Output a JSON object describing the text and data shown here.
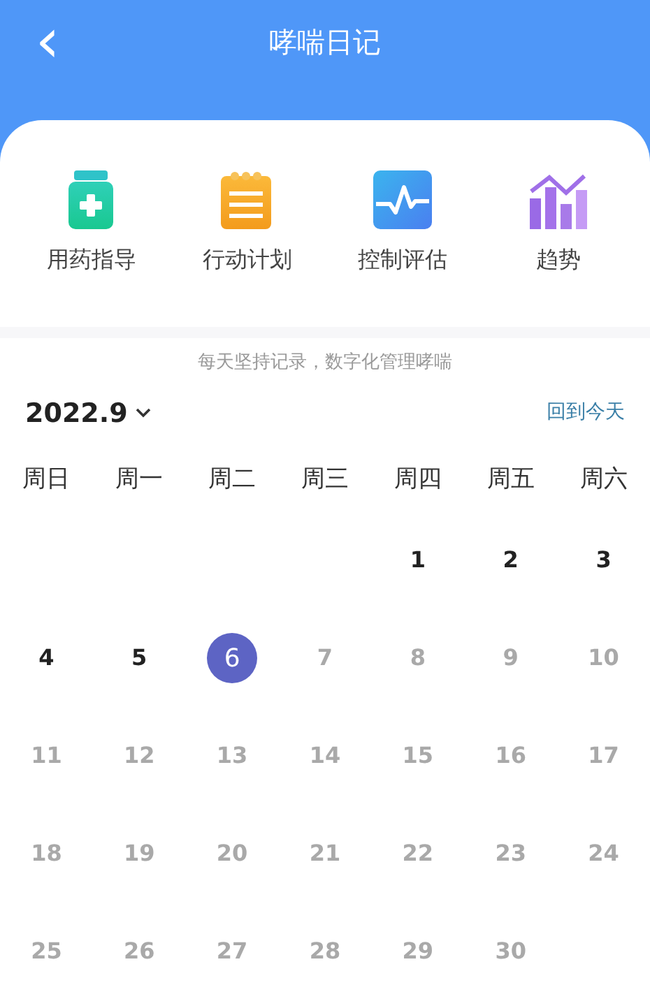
{
  "header": {
    "back": "‹",
    "title": "哮喘日记"
  },
  "shortcuts": [
    {
      "kind": "medicine",
      "label": "用药指导"
    },
    {
      "kind": "plan",
      "label": "行动计划"
    },
    {
      "kind": "assess",
      "label": "控制评估"
    },
    {
      "kind": "trend",
      "label": "趋势"
    }
  ],
  "tagline": "每天坚持记录，数字化管理哮喘",
  "calendar": {
    "month": "2022.9",
    "today_link": "回到今天",
    "weekdays": [
      "周日",
      "周一",
      "周二",
      "周三",
      "周四",
      "周五",
      "周六"
    ],
    "weeks": [
      [
        {
          "kind": "blank"
        },
        {
          "kind": "blank"
        },
        {
          "kind": "blank"
        },
        {
          "kind": "blank"
        },
        {
          "kind": "day",
          "day": "1",
          "selected": false,
          "disabled": false
        },
        {
          "kind": "day",
          "day": "2",
          "selected": false,
          "disabled": false
        },
        {
          "kind": "day",
          "day": "3",
          "selected": false,
          "disabled": false
        }
      ],
      [
        {
          "kind": "day",
          "day": "4",
          "selected": false,
          "disabled": false
        },
        {
          "kind": "day",
          "day": "5",
          "selected": false,
          "disabled": false
        },
        {
          "kind": "day",
          "day": "6",
          "selected": true,
          "disabled": false
        },
        {
          "kind": "day",
          "day": "7",
          "selected": false,
          "disabled": true
        },
        {
          "kind": "day",
          "day": "8",
          "selected": false,
          "disabled": true
        },
        {
          "kind": "day",
          "day": "9",
          "selected": false,
          "disabled": true
        },
        {
          "kind": "day",
          "day": "10",
          "selected": false,
          "disabled": true
        }
      ],
      [
        {
          "kind": "day",
          "day": "11",
          "selected": false,
          "disabled": true
        },
        {
          "kind": "day",
          "day": "12",
          "selected": false,
          "disabled": true
        },
        {
          "kind": "day",
          "day": "13",
          "selected": false,
          "disabled": true
        },
        {
          "kind": "day",
          "day": "14",
          "selected": false,
          "disabled": true
        },
        {
          "kind": "day",
          "day": "15",
          "selected": false,
          "disabled": true
        },
        {
          "kind": "day",
          "day": "16",
          "selected": false,
          "disabled": true
        },
        {
          "kind": "day",
          "day": "17",
          "selected": false,
          "disabled": true
        }
      ],
      [
        {
          "kind": "day",
          "day": "18",
          "selected": false,
          "disabled": true
        },
        {
          "kind": "day",
          "day": "19",
          "selected": false,
          "disabled": true
        },
        {
          "kind": "day",
          "day": "20",
          "selected": false,
          "disabled": true
        },
        {
          "kind": "day",
          "day": "21",
          "selected": false,
          "disabled": true
        },
        {
          "kind": "day",
          "day": "22",
          "selected": false,
          "disabled": true
        },
        {
          "kind": "day",
          "day": "23",
          "selected": false,
          "disabled": true
        },
        {
          "kind": "day",
          "day": "24",
          "selected": false,
          "disabled": true
        }
      ],
      [
        {
          "kind": "day",
          "day": "25",
          "selected": false,
          "disabled": true
        },
        {
          "kind": "day",
          "day": "26",
          "selected": false,
          "disabled": true
        },
        {
          "kind": "day",
          "day": "27",
          "selected": false,
          "disabled": true
        },
        {
          "kind": "day",
          "day": "28",
          "selected": false,
          "disabled": true
        },
        {
          "kind": "day",
          "day": "29",
          "selected": false,
          "disabled": true
        },
        {
          "kind": "day",
          "day": "30",
          "selected": false,
          "disabled": true
        },
        {
          "kind": "blank"
        }
      ]
    ]
  }
}
